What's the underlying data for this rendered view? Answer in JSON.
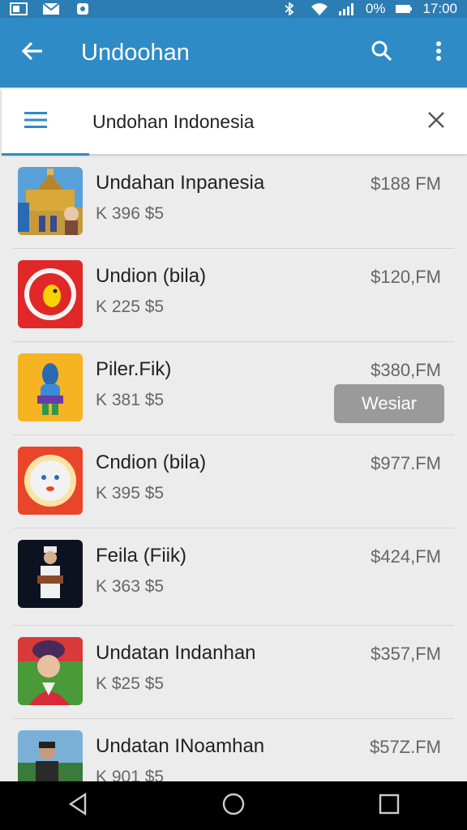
{
  "status_bar": {
    "battery_text": "0%",
    "time": "17:00"
  },
  "app_bar": {
    "title": "Undoohan"
  },
  "tab_bar": {
    "title": "Undohan Indonesia"
  },
  "items": [
    {
      "title": "Undahan Inpanesia",
      "sub": "K 396 $5",
      "price": "$188 FM",
      "icon": "palace-photo"
    },
    {
      "title": "Undion (bila)",
      "sub": "K 225 $5",
      "price": "$120,FM",
      "icon": "red-bird-logo"
    },
    {
      "title": "Piler.Fik)",
      "sub": "K 381 $5",
      "price": "$380,FM",
      "icon": "cartoon-figure",
      "button": "Wesiar"
    },
    {
      "title": "Cndion (bila)",
      "sub": "K 395 $5",
      "price": "$977.FM",
      "icon": "smiley-face-logo"
    },
    {
      "title": "Feila (Fiik)",
      "sub": "K 363 $5",
      "price": "$424,FM",
      "icon": "person-photo"
    },
    {
      "title": "Undatan Indanhan",
      "sub": "K $25 $5",
      "price": "$357,FM",
      "icon": "woman-photo"
    },
    {
      "title": "Undatan INoamhan",
      "sub": "K 901 $5",
      "price": "$57Z.FM",
      "icon": "man-photo"
    }
  ],
  "colors": {
    "app_bar": "#2e8bc6",
    "status_bar": "#2b7db3",
    "accent": "#2e8bc6",
    "button": "#9a9a9a"
  }
}
